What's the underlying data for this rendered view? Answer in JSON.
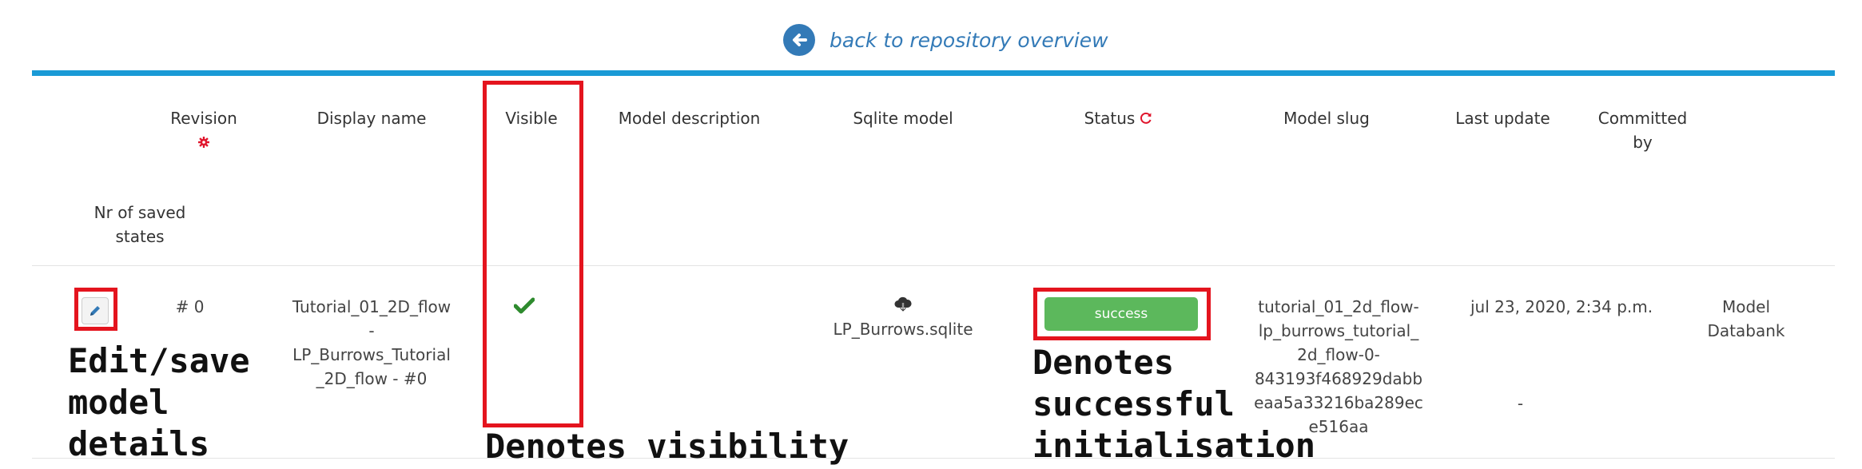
{
  "back_link": {
    "label": "back to repository overview"
  },
  "table": {
    "headers": {
      "revision": "Revision",
      "display_name": "Display name",
      "visible": "Visible",
      "model_description": "Model description",
      "sqlite_model": "Sqlite model",
      "status": "Status",
      "model_slug": "Model slug",
      "last_update": "Last update",
      "committed_by_1": "Committed",
      "committed_by_2": "by",
      "nr_saved_1": "Nr of saved",
      "nr_saved_2": "states"
    },
    "row": {
      "revision": "# 0",
      "display_name_1": "Tutorial_01_2D_flow",
      "display_name_2": "-",
      "display_name_3": "LP_Burrows_Tutorial",
      "display_name_4": "_2D_flow - #0",
      "sqlite_model": "LP_Burrows.sqlite",
      "status": "success",
      "slug_1": "tutorial_01_2d_flow-",
      "slug_2": "lp_burrows_tutorial_",
      "slug_3": "2d_flow-0-",
      "slug_4": "843193f468929dabb",
      "slug_5": "eaa5a33216ba289ec",
      "slug_6": "e516aa",
      "last_update": "jul 23, 2020, 2:34 p.m.",
      "nr_saved_states": "-",
      "committed_by_1": "Model",
      "committed_by_2": "Databank"
    }
  },
  "annotations": {
    "edit": "Edit/save\nmodel\ndetails",
    "visible": "Denotes visibility",
    "status": "Denotes\nsuccessful\ninitialisation"
  },
  "colors": {
    "accent": "#1a9ad6",
    "link": "#337ab7",
    "success": "#5cb85c",
    "highlight_box": "#e4141e",
    "check": "#2e8b2e",
    "icon_red": "#e0152c"
  },
  "icons": [
    "back-arrow-icon",
    "gear-icon",
    "refresh-icon",
    "pencil-icon",
    "checkmark-icon",
    "cloud-download-icon"
  ]
}
